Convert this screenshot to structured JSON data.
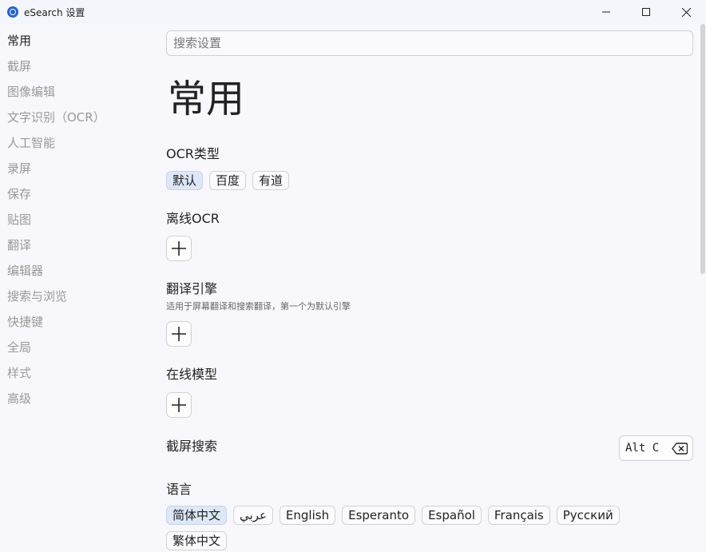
{
  "window": {
    "title": "eSearch 设置"
  },
  "sidebar": {
    "items": [
      {
        "label": "常用",
        "active": true
      },
      {
        "label": "截屏"
      },
      {
        "label": "图像编辑"
      },
      {
        "label": "文字识别（OCR）"
      },
      {
        "label": "人工智能"
      },
      {
        "label": "录屏"
      },
      {
        "label": "保存"
      },
      {
        "label": "贴图"
      },
      {
        "label": "翻译"
      },
      {
        "label": "编辑器"
      },
      {
        "label": "搜索与浏览"
      },
      {
        "label": "快捷键"
      },
      {
        "label": "全局"
      },
      {
        "label": "样式"
      },
      {
        "label": "高级"
      }
    ]
  },
  "search": {
    "placeholder": "搜索设置"
  },
  "main": {
    "title": "常用",
    "ocr_type": {
      "title": "OCR类型",
      "options": [
        "默认",
        "百度",
        "有道"
      ],
      "selected": "默认"
    },
    "offline_ocr": {
      "title": "离线OCR"
    },
    "translate_engine": {
      "title": "翻译引擎",
      "subtitle": "适用于屏幕翻译和搜索翻译，第一个为默认引擎"
    },
    "online_model": {
      "title": "在线模型"
    },
    "screenshot_search": {
      "title": "截屏搜索",
      "shortcut": "Alt C"
    },
    "language": {
      "title": "语言",
      "options": [
        "简体中文",
        "عربي",
        "English",
        "Esperanto",
        "Español",
        "Français",
        "Русский",
        "繁体中文"
      ],
      "selected": "简体中文"
    }
  },
  "colors": {
    "accent": "#1e63d8",
    "selected_chip": "#dde7f7",
    "inactive_text": "#999999"
  }
}
